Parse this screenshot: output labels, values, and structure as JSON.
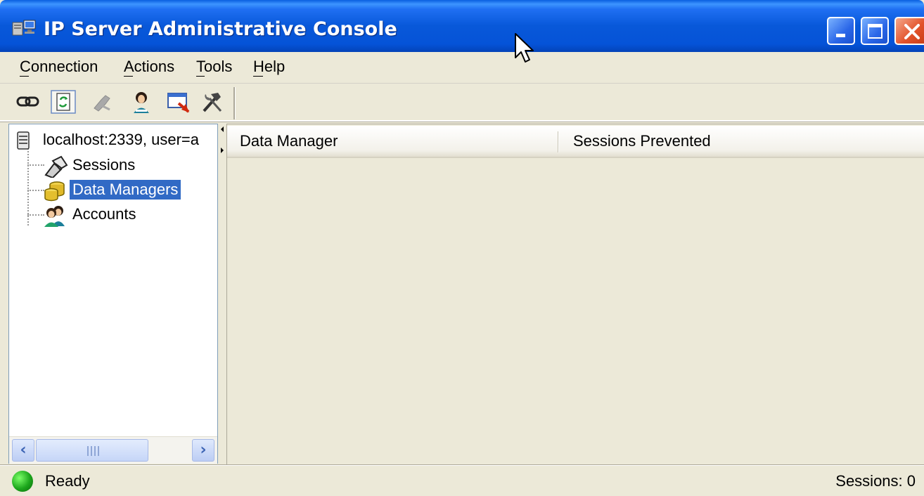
{
  "window": {
    "title": "IP Server Administrative Console",
    "controls": [
      "minimize",
      "maximize",
      "close"
    ]
  },
  "menu": {
    "items": [
      {
        "label": "Connection",
        "mnemonic": "C"
      },
      {
        "label": "Actions",
        "mnemonic": "A"
      },
      {
        "label": "Tools",
        "mnemonic": "T"
      },
      {
        "label": "Help",
        "mnemonic": "H"
      }
    ]
  },
  "toolbar": {
    "buttons": [
      {
        "icon": "connect-link-icon",
        "enabled": true
      },
      {
        "icon": "refresh-icon",
        "enabled": true,
        "pressed": true
      },
      {
        "icon": "disconnect-icon",
        "enabled": false
      },
      {
        "icon": "user-accounts-icon",
        "enabled": true
      },
      {
        "icon": "session-kill-icon",
        "enabled": true
      },
      {
        "icon": "tools-hammer-icon",
        "enabled": true
      }
    ]
  },
  "tree": {
    "root": {
      "label": "localhost:2339, user=a",
      "icon": "server-icon"
    },
    "children": [
      {
        "label": "Sessions",
        "icon": "sessions-icon",
        "selected": false
      },
      {
        "label": "Data Managers",
        "icon": "data-managers-icon",
        "selected": true
      },
      {
        "label": "Accounts",
        "icon": "accounts-icon",
        "selected": false
      }
    ],
    "scrollbar": {
      "thumb_fraction": 0.6
    }
  },
  "list": {
    "columns": [
      "Data Manager",
      "Sessions Prevented"
    ],
    "rows": []
  },
  "status": {
    "text": "Ready",
    "sessions": "Sessions: 0",
    "icon": "globe-icon"
  },
  "colors": {
    "title_bar": "#0553d8",
    "selection": "#316ac5",
    "chrome": "#ece9d8"
  }
}
